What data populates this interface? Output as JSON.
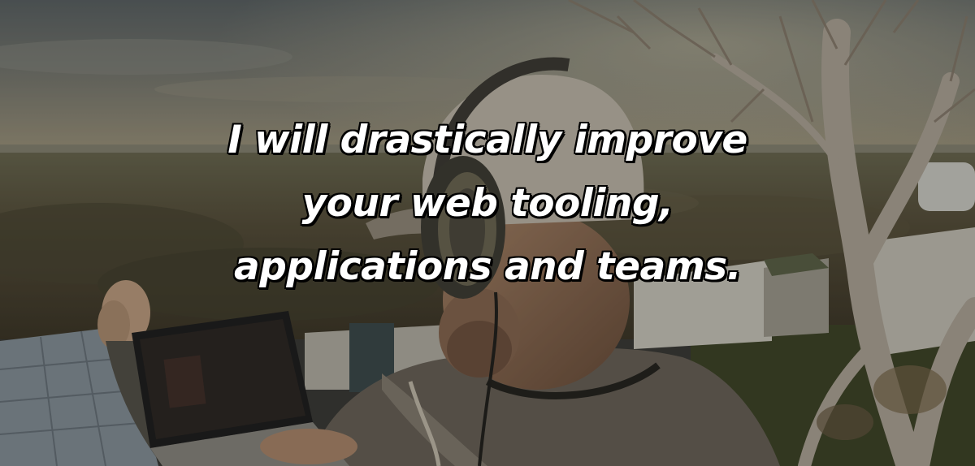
{
  "hero": {
    "headline_lines": [
      "I will drastically improve",
      "your web tooling,",
      "applications and teams."
    ],
    "background": "photo: man wearing headphones and cap working on a laptop outdoors, overlooking wetlands at sunset, with a bare tree on the right"
  },
  "colors": {
    "headline_text": "#ffffff",
    "headline_outline": "#000000",
    "overlay": "#141412"
  }
}
